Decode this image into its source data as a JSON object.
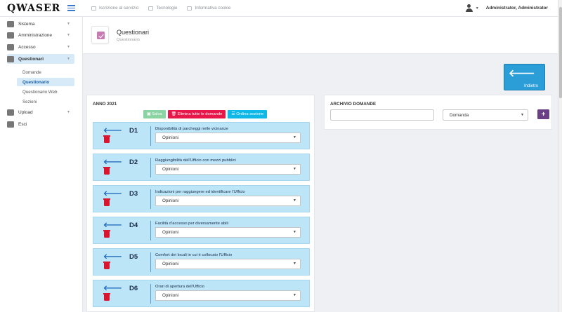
{
  "app": {
    "logo": "QWASER"
  },
  "topbar": {
    "links": [
      "Iscrizione al servizio",
      "Tecnologie",
      "Informativa cookie"
    ],
    "user": "Administrator, Administrator"
  },
  "sidebar": {
    "items": [
      {
        "label": "Sistema",
        "icon": "sitemap-icon"
      },
      {
        "label": "Amministrazione",
        "icon": "gear-icon"
      },
      {
        "label": "Accesso",
        "icon": "key-icon"
      },
      {
        "label": "Questionari",
        "icon": "checklist-icon"
      },
      {
        "label": "Upload",
        "icon": "upload-icon"
      },
      {
        "label": "Esci",
        "icon": "logout-icon"
      }
    ],
    "subitems": [
      "Domande",
      "Questionario",
      "Questionario Web",
      "Sezioni"
    ]
  },
  "header": {
    "title": "Questionari",
    "subtitle": "Questionario"
  },
  "back_button": {
    "label": "Indietro"
  },
  "left_panel": {
    "title": "ANNO 2021",
    "buttons": {
      "save": "Salva",
      "delete_all": "Elimina tutte le domande",
      "order": "Ordina sezione"
    },
    "questions": [
      {
        "code": "D1",
        "text": "Disponibilità di parcheggi nelle vicinanze",
        "value": "Opinioni"
      },
      {
        "code": "D2",
        "text": "Raggiungibilità dell'Ufficio con mezzi pubblici",
        "value": "Opinioni"
      },
      {
        "code": "D3",
        "text": "Indicazioni per raggiungere ed identificare l'Ufficio",
        "value": "Opinioni"
      },
      {
        "code": "D4",
        "text": "Facilità d'accesso per diversamente abili",
        "value": "Opinioni"
      },
      {
        "code": "D5",
        "text": "Comfort dei locali in cui è collocato l'Ufficio",
        "value": "Opinioni"
      },
      {
        "code": "D6",
        "text": "Orari di apertura dell'Ufficio",
        "value": "Opinioni"
      }
    ]
  },
  "right_panel": {
    "title": "ARCHIVIO DOMANDE",
    "search_value": "",
    "select_value": "Domanda",
    "add_label": "+"
  },
  "colors": {
    "accent": "#2c9ed7",
    "card": "#bde5f8",
    "danger": "#e8174a",
    "info": "#10b8e8",
    "success": "#8cd3a4",
    "purple": "#6a3f86"
  }
}
